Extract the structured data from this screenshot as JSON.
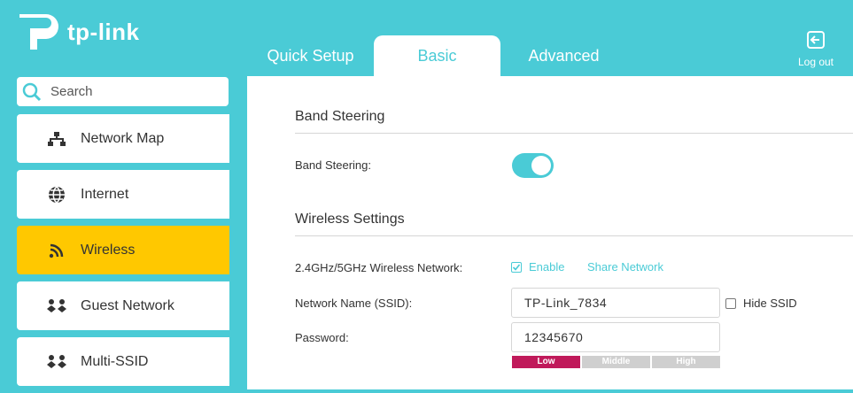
{
  "header": {
    "brand": "tp-link",
    "tabs": [
      {
        "label": "Quick Setup",
        "active": false
      },
      {
        "label": "Basic",
        "active": true
      },
      {
        "label": "Advanced",
        "active": false
      }
    ],
    "logout_label": "Log out"
  },
  "sidebar": {
    "search_placeholder": "Search",
    "items": [
      {
        "label": "Network Map",
        "icon": "network-map-icon",
        "active": false
      },
      {
        "label": "Internet",
        "icon": "globe-icon",
        "active": false
      },
      {
        "label": "Wireless",
        "icon": "wifi-icon",
        "active": true
      },
      {
        "label": "Guest Network",
        "icon": "guest-network-icon",
        "active": false
      },
      {
        "label": "Multi-SSID",
        "icon": "multi-ssid-icon",
        "active": false
      }
    ]
  },
  "main": {
    "band_steering": {
      "section_title": "Band Steering",
      "label": "Band Steering:",
      "enabled": true
    },
    "wireless_settings": {
      "section_title": "Wireless Settings",
      "network_label": "2.4GHz/5GHz Wireless Network:",
      "enable_label": "Enable",
      "enable_checked": true,
      "share_label": "Share Network",
      "ssid_label": "Network Name (SSID):",
      "ssid_value": "TP-Link_7834",
      "hide_ssid_label": "Hide SSID",
      "hide_ssid_checked": false,
      "password_label": "Password:",
      "password_value": "12345670",
      "strength_levels": [
        "Low",
        "Middle",
        "High"
      ],
      "strength_current": "Low"
    }
  },
  "colors": {
    "accent": "#4acbd6",
    "active_nav": "#ffc800",
    "strength_low": "#c0195a"
  }
}
